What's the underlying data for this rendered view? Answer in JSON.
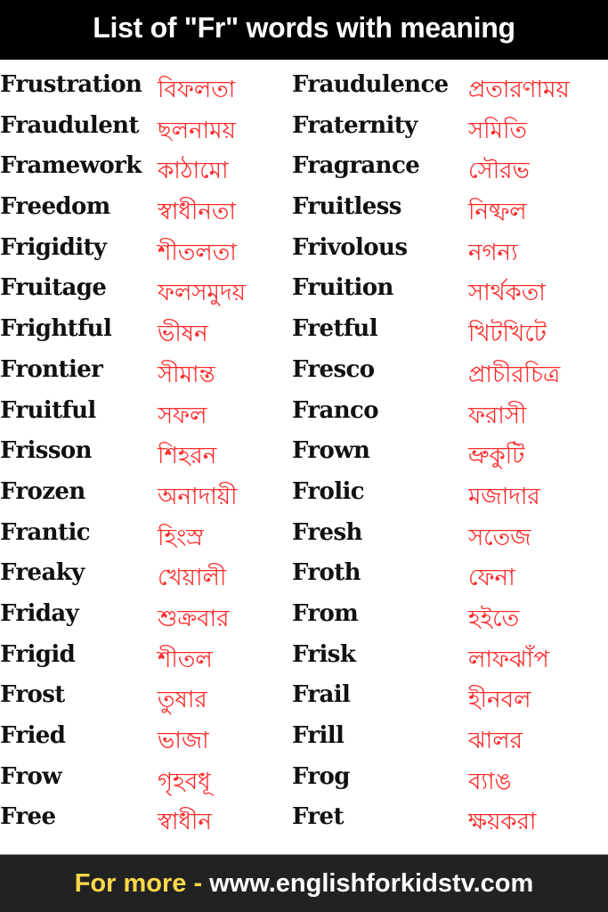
{
  "header": {
    "title": "List of \"Fr\" words with meaning"
  },
  "colors": {
    "header_bg": "#000000",
    "footer_bg": "#222222",
    "english": "#111111",
    "bengali": "#ff2a2a",
    "footer_prefix": "#ffd84a",
    "footer_url": "#ffffff"
  },
  "rows": [
    [
      {
        "en": "Frustration",
        "bn": "বিফলতা"
      },
      {
        "en": "Fraudulence",
        "bn": "প্রতারণাময়"
      }
    ],
    [
      {
        "en": "Fraudulent",
        "bn": "ছলনাময়"
      },
      {
        "en": "Fraternity",
        "bn": "সমিতি"
      }
    ],
    [
      {
        "en": "Framework",
        "bn": "কাঠামো"
      },
      {
        "en": "Fragrance",
        "bn": "সৌরভ"
      }
    ],
    [
      {
        "en": "Freedom",
        "bn": "স্বাধীনতা"
      },
      {
        "en": "Fruitless",
        "bn": "নিষ্ফল"
      }
    ],
    [
      {
        "en": "Frigidity",
        "bn": "শীতলতা"
      },
      {
        "en": "Frivolous",
        "bn": "নগন্য"
      }
    ],
    [
      {
        "en": "Fruitage",
        "bn": "ফলসমুদয়"
      },
      {
        "en": "Fruition",
        "bn": "সার্থকতা"
      }
    ],
    [
      {
        "en": "Frightful",
        "bn": "ভীষন"
      },
      {
        "en": "Fretful",
        "bn": "খিটখিটে"
      }
    ],
    [
      {
        "en": "Frontier",
        "bn": "সীমান্ত"
      },
      {
        "en": "Fresco",
        "bn": "প্রাচীরচিত্র"
      }
    ],
    [
      {
        "en": "Fruitful",
        "bn": "সফল"
      },
      {
        "en": "Franco",
        "bn": "ফরাসী"
      }
    ],
    [
      {
        "en": "Frisson",
        "bn": "শিহরন"
      },
      {
        "en": "Frown",
        "bn": "ভ্রুকুটি"
      }
    ],
    [
      {
        "en": "Frozen",
        "bn": "অনাদায়ী"
      },
      {
        "en": "Frolic",
        "bn": "মজাদার"
      }
    ],
    [
      {
        "en": "Frantic",
        "bn": "হিংস্র"
      },
      {
        "en": "Fresh",
        "bn": "সতেজ"
      }
    ],
    [
      {
        "en": "Freaky",
        "bn": "খেয়ালী"
      },
      {
        "en": "Froth",
        "bn": "ফেনা"
      }
    ],
    [
      {
        "en": "Friday",
        "bn": "শুক্রবার"
      },
      {
        "en": "From",
        "bn": "হইতে"
      }
    ],
    [
      {
        "en": "Frigid",
        "bn": "শীতল"
      },
      {
        "en": "Frisk",
        "bn": "লাফঝাঁপ"
      }
    ],
    [
      {
        "en": "Frost",
        "bn": "তুষার"
      },
      {
        "en": "Frail",
        "bn": "হীনবল"
      }
    ],
    [
      {
        "en": "Fried",
        "bn": "ভাজা"
      },
      {
        "en": "Frill",
        "bn": "ঝালর"
      }
    ],
    [
      {
        "en": "Frow",
        "bn": "গৃহবধূ"
      },
      {
        "en": "Frog",
        "bn": "ব্যাঙ"
      }
    ],
    [
      {
        "en": "Free",
        "bn": "স্বাধীন"
      },
      {
        "en": "Fret",
        "bn": "ক্ষয়করা"
      }
    ]
  ],
  "footer": {
    "prefix": "For more -",
    "url": "www.englishforkidstv.com"
  }
}
